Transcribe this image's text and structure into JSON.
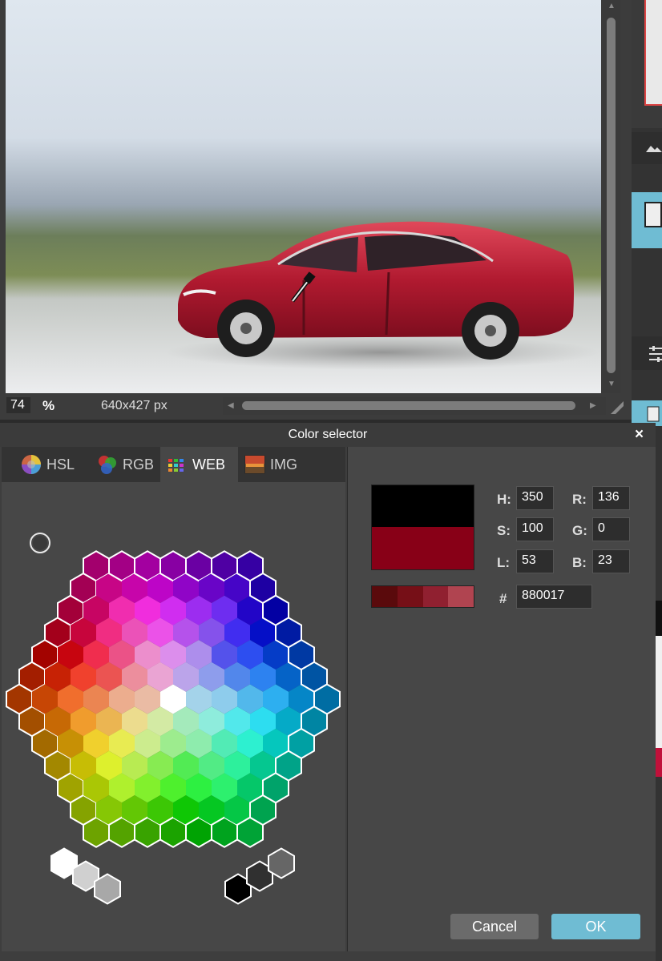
{
  "canvas": {
    "zoom_value": "74",
    "zoom_unit": "%",
    "image_size": "640x427 px"
  },
  "dialog": {
    "title": "Color selector",
    "close_glyph": "×",
    "tabs": [
      {
        "label": "HSL",
        "icon": "color-wheel-icon",
        "active": false
      },
      {
        "label": "RGB",
        "icon": "rgb-circles-icon",
        "active": false
      },
      {
        "label": "WEB",
        "icon": "web-swatches-icon",
        "active": true
      },
      {
        "label": "IMG",
        "icon": "image-icon",
        "active": false
      }
    ],
    "current_color": "#000000",
    "selected_color": "#880017",
    "shades": [
      "#5a0a0c",
      "#760f17",
      "#902030",
      "#b04450"
    ],
    "fields": {
      "h": {
        "label": "H:",
        "value": "350"
      },
      "s": {
        "label": "S:",
        "value": "100"
      },
      "l": {
        "label": "L:",
        "value": "53"
      },
      "r": {
        "label": "R:",
        "value": "136"
      },
      "g": {
        "label": "G:",
        "value": "0"
      },
      "b": {
        "label": "B:",
        "value": "23"
      },
      "hex": {
        "label": "#",
        "value": "880017"
      }
    },
    "cancel_label": "Cancel",
    "ok_label": "OK"
  },
  "colors": {
    "accent": "#6fbcd3",
    "dialog_bg": "#474747"
  }
}
